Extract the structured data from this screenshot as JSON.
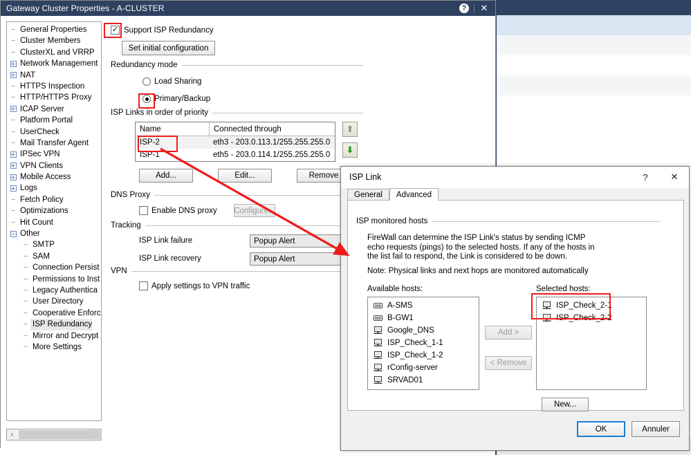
{
  "background": {
    "name": "smartconsole-listview"
  },
  "main_window": {
    "title": "Gateway Cluster Properties - A-CLUSTER",
    "titlebar_buttons": [
      {
        "name": "help-icon",
        "glyph": "?"
      },
      {
        "name": "close-icon",
        "glyph": "✕"
      }
    ]
  },
  "sidebar": {
    "items": [
      {
        "label": "General Properties",
        "toggle": "leaf",
        "indent": 0
      },
      {
        "label": "Cluster Members",
        "toggle": "leaf",
        "indent": 0
      },
      {
        "label": "ClusterXL and VRRP",
        "toggle": "leaf",
        "indent": 0
      },
      {
        "label": "Network Management",
        "toggle": "plus",
        "indent": 0
      },
      {
        "label": "NAT",
        "toggle": "plus",
        "indent": 0
      },
      {
        "label": "HTTPS Inspection",
        "toggle": "leaf",
        "indent": 0
      },
      {
        "label": "HTTP/HTTPS Proxy",
        "toggle": "leaf",
        "indent": 0
      },
      {
        "label": "ICAP Server",
        "toggle": "plus",
        "indent": 0
      },
      {
        "label": "Platform Portal",
        "toggle": "leaf",
        "indent": 0
      },
      {
        "label": "UserCheck",
        "toggle": "leaf",
        "indent": 0
      },
      {
        "label": "Mail Transfer Agent",
        "toggle": "leaf",
        "indent": 0
      },
      {
        "label": "IPSec VPN",
        "toggle": "plus",
        "indent": 0
      },
      {
        "label": "VPN Clients",
        "toggle": "plus",
        "indent": 0
      },
      {
        "label": "Mobile Access",
        "toggle": "plus",
        "indent": 0
      },
      {
        "label": "Logs",
        "toggle": "plus",
        "indent": 0
      },
      {
        "label": "Fetch Policy",
        "toggle": "leaf",
        "indent": 0
      },
      {
        "label": "Optimizations",
        "toggle": "leaf",
        "indent": 0
      },
      {
        "label": "Hit Count",
        "toggle": "leaf",
        "indent": 0
      },
      {
        "label": "Other",
        "toggle": "minus",
        "indent": 0
      },
      {
        "label": "SMTP",
        "toggle": "leaf",
        "indent": 1
      },
      {
        "label": "SAM",
        "toggle": "leaf",
        "indent": 1
      },
      {
        "label": "Connection Persist",
        "toggle": "leaf",
        "indent": 1
      },
      {
        "label": "Permissions to Inst",
        "toggle": "leaf",
        "indent": 1
      },
      {
        "label": "Legacy Authentica",
        "toggle": "leaf",
        "indent": 1
      },
      {
        "label": "User Directory",
        "toggle": "leaf",
        "indent": 1
      },
      {
        "label": "Cooperative Enforc",
        "toggle": "leaf",
        "indent": 1
      },
      {
        "label": "ISP Redundancy",
        "toggle": "leaf",
        "indent": 1,
        "selected": true
      },
      {
        "label": "Mirror and Decrypt",
        "toggle": "leaf",
        "indent": 1
      },
      {
        "label": "More Settings",
        "toggle": "leaf",
        "indent": 1
      }
    ],
    "scrollbar": {
      "left_arrow": "‹",
      "right_arrow": "›"
    }
  },
  "isp_redundancy_page": {
    "support_checkbox": {
      "label": "Support ISP Redundancy",
      "checked": true,
      "check_glyph": "✓"
    },
    "set_initial_configuration_button": "Set initial configuration",
    "redundancy_mode": {
      "group_label": "Redundancy mode",
      "options": [
        {
          "label": "Load Sharing",
          "selected": false
        },
        {
          "label": "Primary/Backup",
          "selected": true
        }
      ]
    },
    "isp_links": {
      "group_label": "ISP Links in order of priority",
      "columns": [
        "Name",
        "Connected through"
      ],
      "rows": [
        {
          "name": "ISP-2",
          "connected_through": "eth3 - 203.0.113.1/255.255.255.0",
          "selected": true
        },
        {
          "name": "ISP-1",
          "connected_through": "eth5 - 203.0.114.1/255.255.255.0",
          "selected": false
        }
      ],
      "move_up_icon": "⬆",
      "move_down_icon": "⬇",
      "buttons": [
        {
          "label": "Add...",
          "name": "add-isp-link-button"
        },
        {
          "label": "Edit...",
          "name": "edit-isp-link-button"
        },
        {
          "label": "Remove",
          "name": "remove-isp-link-button"
        }
      ]
    },
    "dns_proxy": {
      "group_label": "DNS Proxy",
      "enable_label": "Enable DNS proxy",
      "enable_checked": false,
      "configure_button": "Configure...",
      "configure_enabled": false
    },
    "tracking": {
      "group_label": "Tracking",
      "rows": [
        {
          "label": "ISP Link failure",
          "value": "Popup Alert"
        },
        {
          "label": "ISP Link recovery",
          "value": "Popup Alert"
        }
      ]
    },
    "vpn": {
      "group_label": "VPN",
      "apply_label": "Apply settings to VPN traffic",
      "apply_checked": false
    }
  },
  "isp_link_dialog": {
    "title": "ISP Link",
    "titlebar_buttons": [
      {
        "name": "help-icon",
        "glyph": "?"
      },
      {
        "name": "close-icon",
        "glyph": "✕"
      }
    ],
    "tabs": [
      {
        "label": "General",
        "active": false
      },
      {
        "label": "Advanced",
        "active": true
      }
    ],
    "group_label": "ISP monitored hosts",
    "description": "FireWall can determine the ISP Link's status by sending ICMP echo requests (pings) to the selected hosts. If any of the hosts in the list fail to respond, the Link is considered to be down.",
    "note": "Note: Physical links and next hops are monitored automatically",
    "available_label": "Available hosts:",
    "selected_label": "Selected hosts:",
    "available_hosts": [
      {
        "label": "A-SMS",
        "icon": "gateway-icon"
      },
      {
        "label": "B-GW1",
        "icon": "gateway-icon"
      },
      {
        "label": "Google_DNS",
        "icon": "host-icon"
      },
      {
        "label": "ISP_Check_1-1",
        "icon": "host-icon"
      },
      {
        "label": "ISP_Check_1-2",
        "icon": "host-icon"
      },
      {
        "label": "rConfig-server",
        "icon": "host-icon"
      },
      {
        "label": "SRVAD01",
        "icon": "host-icon"
      }
    ],
    "selected_hosts": [
      {
        "label": "ISP_Check_2-1",
        "icon": "host-icon"
      },
      {
        "label": "ISP_Check_2-2",
        "icon": "host-icon"
      }
    ],
    "add_button": {
      "label": "Add  >",
      "enabled": false
    },
    "remove_button": {
      "label": "<  Remove",
      "enabled": false
    },
    "new_button": {
      "label": "New...",
      "enabled": true
    },
    "ok_button": "OK",
    "cancel_button": "Annuler"
  },
  "annotations": {
    "color": "#ef1b1b",
    "boxes": [
      {
        "name": "highlight-support-checkbox"
      },
      {
        "name": "highlight-primary-backup-radio"
      },
      {
        "name": "highlight-isp2-row"
      },
      {
        "name": "highlight-selected-hosts"
      }
    ],
    "arrow": {
      "name": "annotation-arrow",
      "from": "isp2-row",
      "to": "isp-link-dialog"
    }
  }
}
